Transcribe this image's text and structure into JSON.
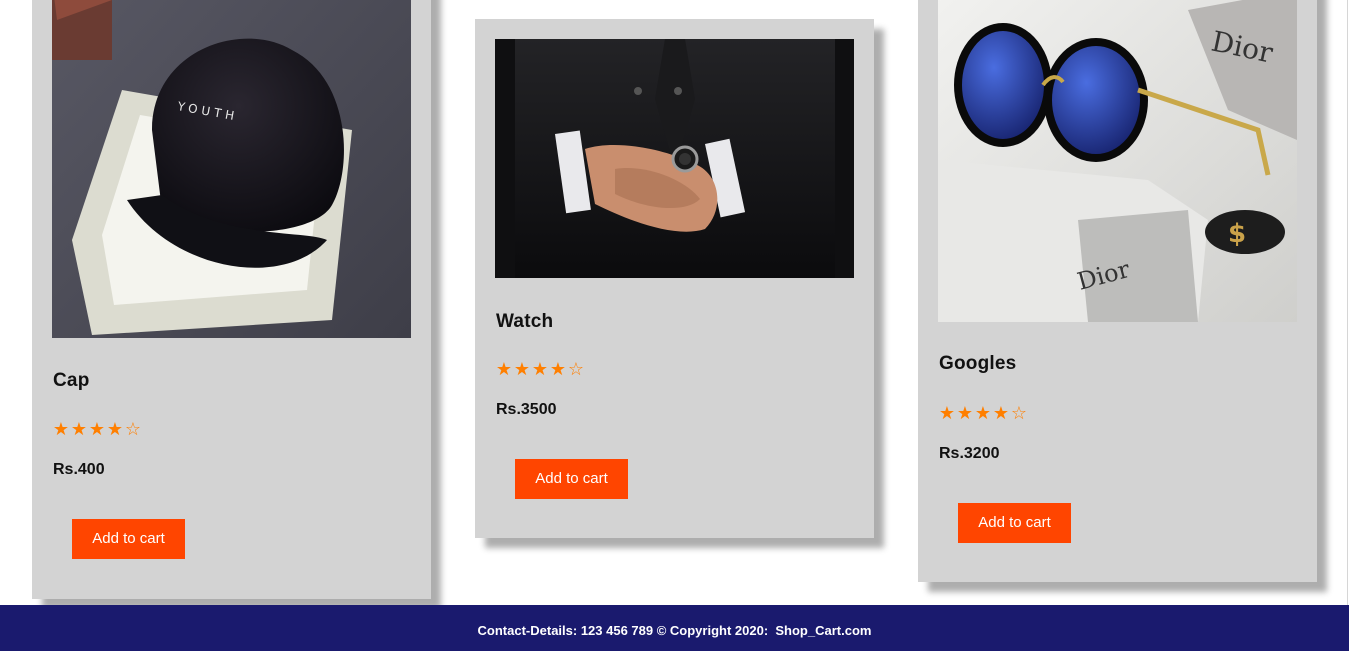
{
  "products": [
    {
      "name": "Cap",
      "rating": 4,
      "rating_max": 5,
      "price": "Rs.400",
      "button_label": "Add to cart",
      "image_text": "YOUTH"
    },
    {
      "name": "Watch",
      "rating": 4,
      "rating_max": 5,
      "price": "Rs.3500",
      "button_label": "Add to cart"
    },
    {
      "name": "Googles",
      "rating": 4,
      "rating_max": 5,
      "price": "Rs.3200",
      "button_label": "Add to cart",
      "image_text": "Dior"
    }
  ],
  "footer": {
    "text": "Contact-Details: 123 456 789 © Copyright 2020:  Shop_Cart.com"
  },
  "colors": {
    "card_bg": "#d3d3d3",
    "button_bg": "#ff4500",
    "star": "#ff7f00",
    "footer_bg": "#1a1a6e"
  },
  "icons": {
    "star_filled": "star-icon",
    "star_empty": "star-outline-icon"
  }
}
